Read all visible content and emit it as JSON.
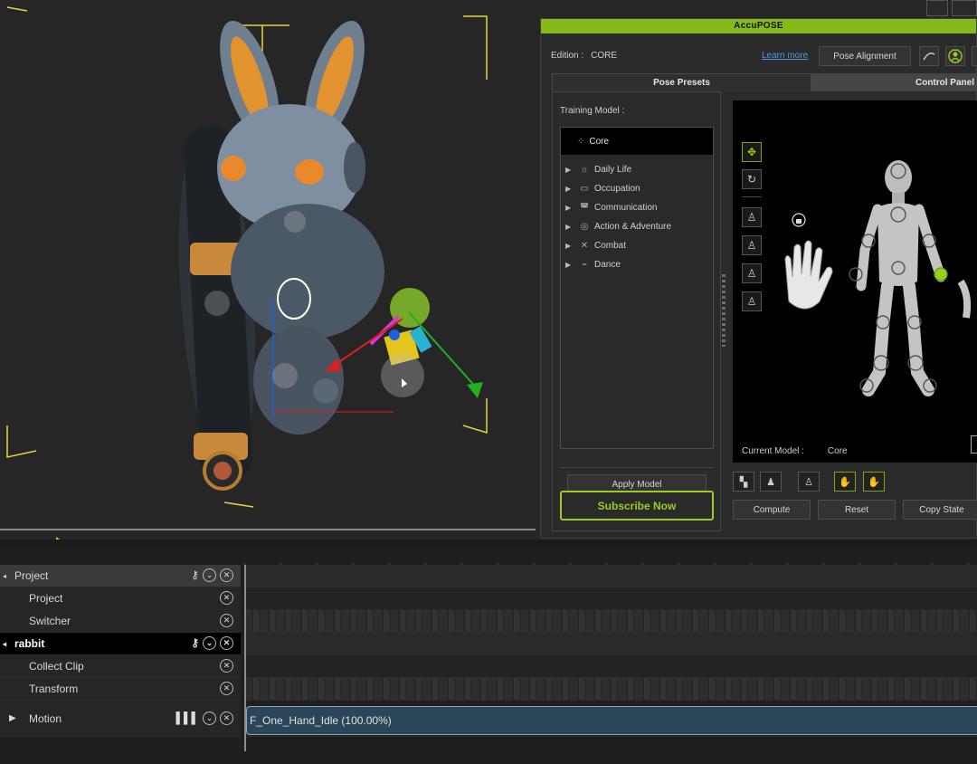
{
  "panel": {
    "title": "AccuPOSE",
    "edition_label": "Edition :",
    "edition_value": "CORE",
    "learn_more": "Learn more",
    "pose_alignment": "Pose Alignment",
    "tabs": [
      {
        "label": "Pose Presets",
        "active": true
      },
      {
        "label": "Control Panel",
        "active": false
      }
    ],
    "training_model_label": "Training Model :",
    "core_item": "Core",
    "tree_items": [
      {
        "label": "Daily Life",
        "icon": "sun-icon"
      },
      {
        "label": "Occupation",
        "icon": "briefcase-icon"
      },
      {
        "label": "Communication",
        "icon": "chat-icon"
      },
      {
        "label": "Action & Adventure",
        "icon": "compass-icon"
      },
      {
        "label": "Combat",
        "icon": "crossed-swords-icon"
      },
      {
        "label": "Dance",
        "icon": "dance-icon"
      }
    ],
    "apply_model": "Apply Model",
    "subscribe": "Subscribe Now",
    "current_model_label": "Current Model :",
    "current_model_value": "Core",
    "compute": "Compute",
    "reset": "Reset",
    "copy_state": "Copy State"
  },
  "timeline": {
    "rows": [
      {
        "label": "Project",
        "kind": "group"
      },
      {
        "label": "Project",
        "kind": "sub"
      },
      {
        "label": "Switcher",
        "kind": "sub"
      },
      {
        "label": "rabbit",
        "kind": "group-selected"
      },
      {
        "label": "Collect Clip",
        "kind": "sub"
      },
      {
        "label": "Transform",
        "kind": "sub"
      },
      {
        "label": "Motion",
        "kind": "expandable"
      }
    ],
    "clip_label": "F_One_Hand_Idle (100.00%)"
  },
  "colors": {
    "accent_green": "#86b91a",
    "link_blue": "#4e96e0",
    "clip_blue": "#2a4658"
  }
}
